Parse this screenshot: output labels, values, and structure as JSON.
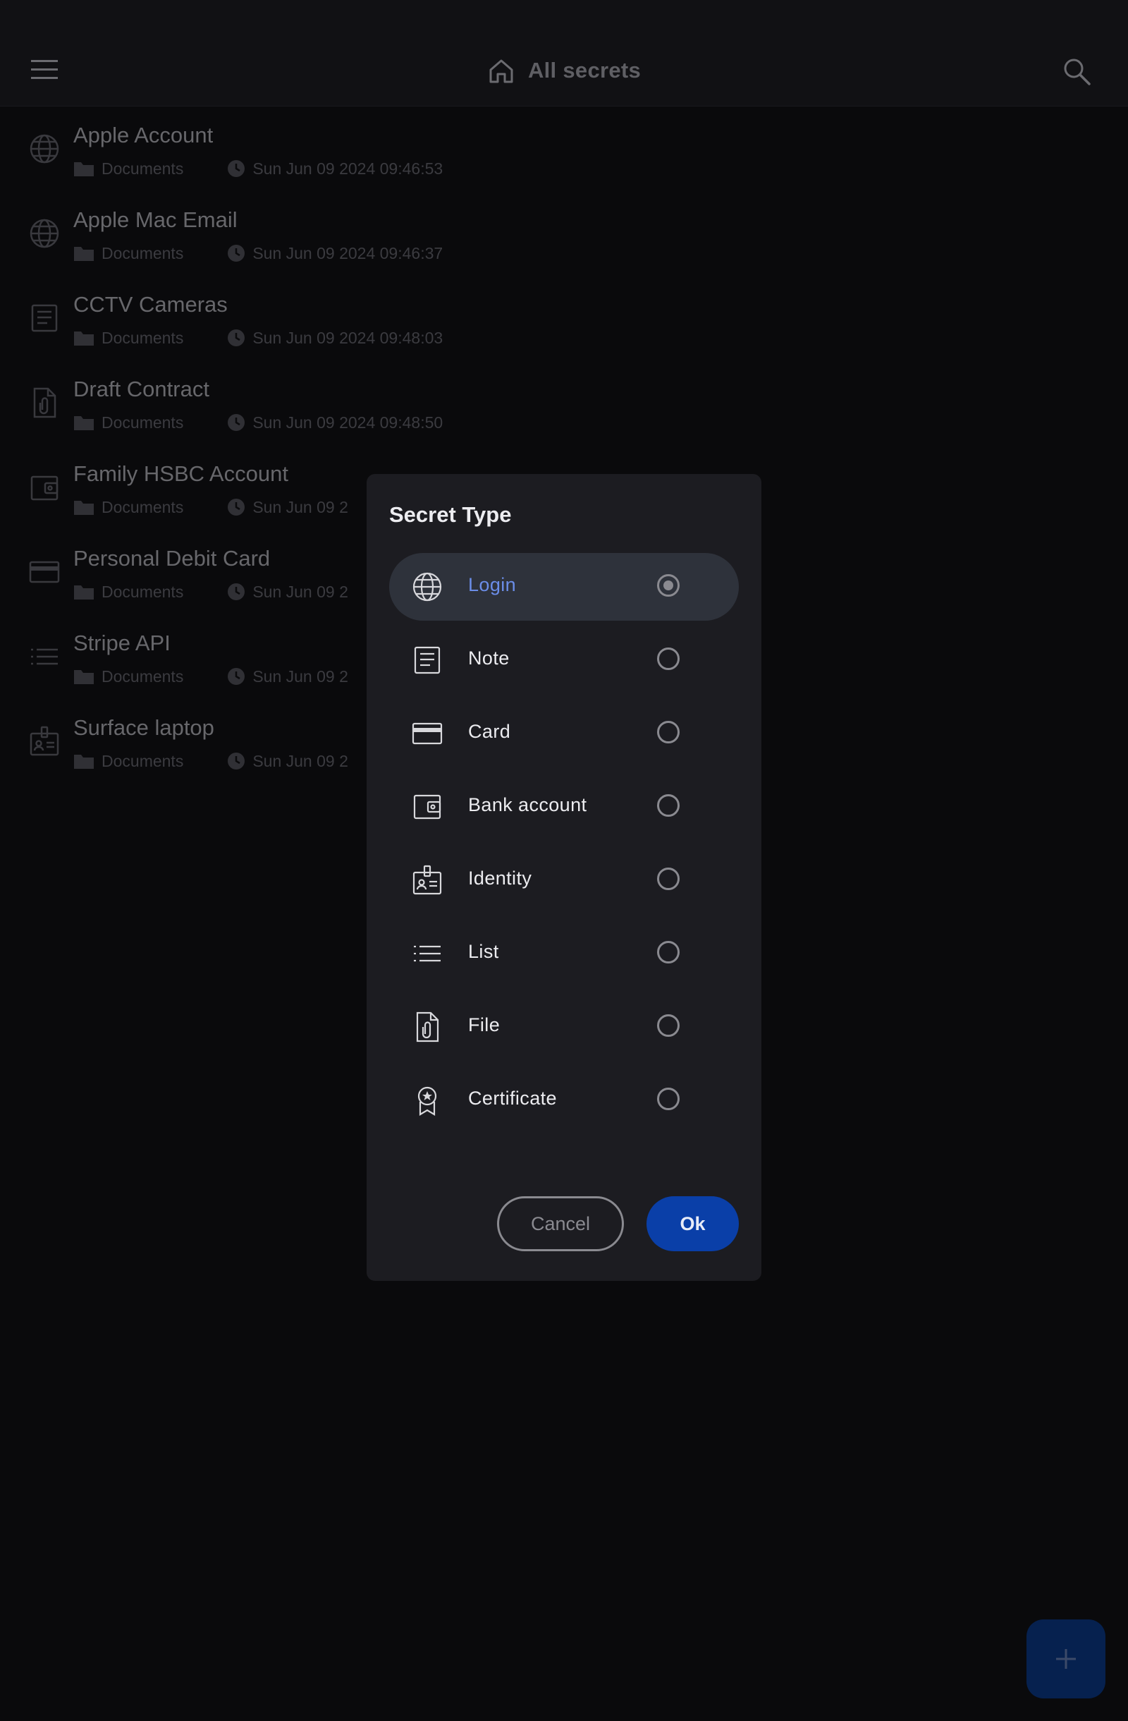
{
  "app_bar": {
    "title": "All secrets",
    "icons": {
      "menu": "menu-icon",
      "home": "home-icon",
      "search": "search-icon"
    }
  },
  "secrets": [
    {
      "title": "Apple Account",
      "type": "login",
      "folder": "Documents",
      "timestamp": "Sun Jun 09 2024 09:46:53"
    },
    {
      "title": "Apple Mac Email",
      "type": "login",
      "folder": "Documents",
      "timestamp": "Sun Jun 09 2024 09:46:37"
    },
    {
      "title": "CCTV Cameras",
      "type": "note",
      "folder": "Documents",
      "timestamp": "Sun Jun 09 2024 09:48:03"
    },
    {
      "title": "Draft Contract",
      "type": "file",
      "folder": "Documents",
      "timestamp": "Sun Jun 09 2024 09:48:50"
    },
    {
      "title": "Family HSBC Account",
      "type": "bank",
      "folder": "Documents",
      "timestamp": "Sun Jun 09 2"
    },
    {
      "title": "Personal Debit Card",
      "type": "card",
      "folder": "Documents",
      "timestamp": "Sun Jun 09 2"
    },
    {
      "title": "Stripe API",
      "type": "list",
      "folder": "Documents",
      "timestamp": "Sun Jun 09 2"
    },
    {
      "title": "Surface laptop",
      "type": "identity",
      "folder": "Documents",
      "timestamp": "Sun Jun 09 2"
    }
  ],
  "dialog": {
    "title": "Secret Type",
    "options": [
      {
        "label": "Login",
        "icon": "globe-icon",
        "selected": true
      },
      {
        "label": "Note",
        "icon": "note-icon",
        "selected": false
      },
      {
        "label": "Card",
        "icon": "credit-card-icon",
        "selected": false
      },
      {
        "label": "Bank account",
        "icon": "wallet-icon",
        "selected": false
      },
      {
        "label": "Identity",
        "icon": "id-badge-icon",
        "selected": false
      },
      {
        "label": "List",
        "icon": "list-icon",
        "selected": false
      },
      {
        "label": "File",
        "icon": "file-attachment-icon",
        "selected": false
      },
      {
        "label": "Certificate",
        "icon": "certificate-icon",
        "selected": false
      }
    ],
    "cancel_label": "Cancel",
    "ok_label": "Ok"
  },
  "fab": {
    "icon": "plus-icon"
  },
  "colors": {
    "background": "#0d0d10",
    "app_bar": "#16161a",
    "dialog": "#1c1c21",
    "selected_option_bg": "#2e323b",
    "accent_text": "#6b8de8",
    "primary_button": "#0a3fa8",
    "fab": "#082b66"
  }
}
